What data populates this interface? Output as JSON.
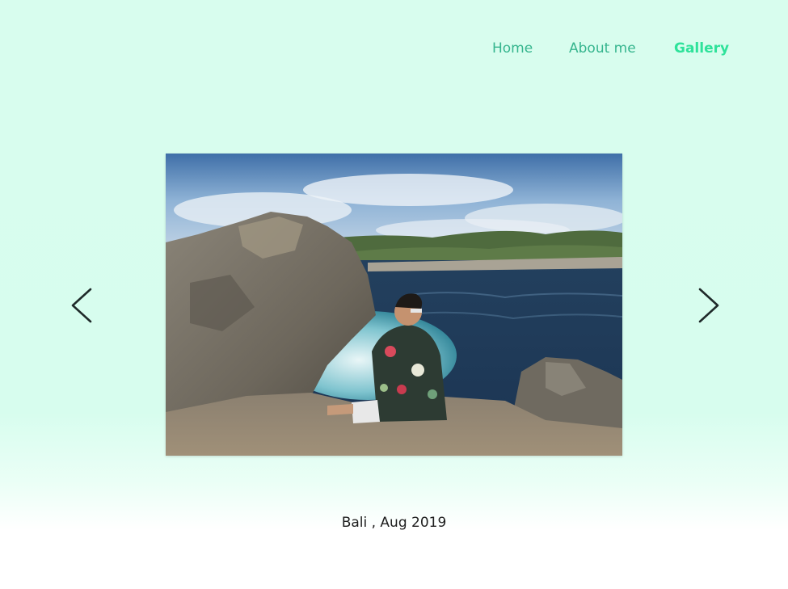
{
  "nav": {
    "items": [
      {
        "label": "Home",
        "active": false
      },
      {
        "label": "About me",
        "active": false
      },
      {
        "label": "Gallery",
        "active": true
      }
    ],
    "active_color": "#2ee29a",
    "color": "#36b58e"
  },
  "gallery": {
    "prev_icon": "chevron-left-icon",
    "next_icon": "chevron-right-icon",
    "photo_icon": "photo-image",
    "caption": "Bali , Aug 2019"
  },
  "colors": {
    "background": "#d8fdee",
    "text": "#1e1e1e"
  }
}
